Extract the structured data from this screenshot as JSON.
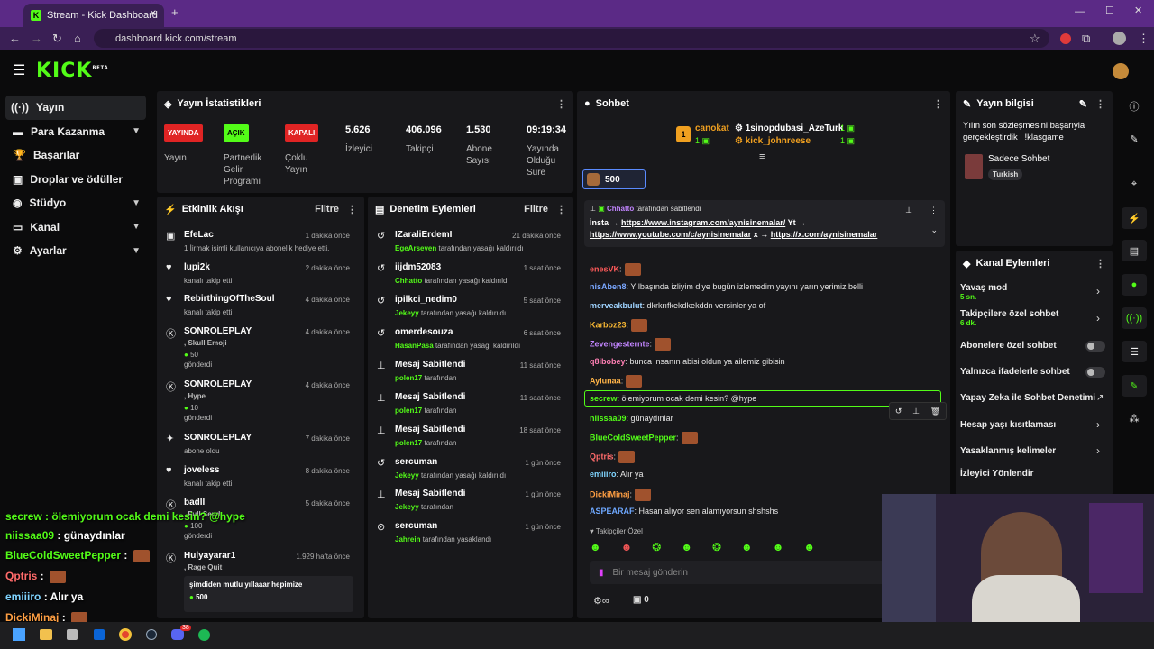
{
  "browser": {
    "tab_title": "Stream - Kick Dashboard",
    "url": "dashboard.kick.com/stream"
  },
  "logo": "KICK",
  "logo_sup": "BETA",
  "sidebar": [
    {
      "label": "Yayın",
      "icon": "antenna-icon"
    },
    {
      "label": "Para Kazanma",
      "icon": "money-icon"
    },
    {
      "label": "Başarılar",
      "icon": "trophy-icon"
    },
    {
      "label": "Droplar ve ödüller",
      "icon": "gift-icon"
    },
    {
      "label": "Stüdyo",
      "icon": "camera-icon"
    },
    {
      "label": "Kanal",
      "icon": "tv-icon"
    },
    {
      "label": "Ayarlar",
      "icon": "gear-icon"
    }
  ],
  "stats": {
    "title": "Yayın İstatistikleri",
    "items": [
      {
        "badge": "YAYINDA",
        "label": "Yayın"
      },
      {
        "badge": "AÇIK",
        "label": "Partnerlik Gelir Programı"
      },
      {
        "badge": "KAPALI",
        "label": "Çoklu Yayın"
      },
      {
        "value": "5.626",
        "label": "İzleyici"
      },
      {
        "value": "406.096",
        "label": "Takipçi"
      },
      {
        "value": "1.530",
        "label": "Abone Sayısı"
      },
      {
        "value": "09:19:34",
        "label": "Yayında Olduğu Süre"
      }
    ]
  },
  "activity": {
    "title": "Etkinlik Akışı",
    "filter": "Filtre",
    "items": [
      {
        "name": "EfeLac",
        "text": "1 İirmak isimli kullanıcıya abonelik hediye etti.",
        "time": "1 dakika önce"
      },
      {
        "name": "lupi2k",
        "text": "kanalı takip etti",
        "time": "2 dakika önce"
      },
      {
        "name": "RebirthingOfTheSoul",
        "text": "kanalı takip etti",
        "time": "4 dakika önce"
      },
      {
        "name": "SONROLEPLAY",
        "text": ", Skull Emoji",
        "amount": "50",
        "text2": "gönderdi",
        "time": "4 dakika önce"
      },
      {
        "name": "SONROLEPLAY",
        "text": ", Hype",
        "amount": "10",
        "text2": "gönderdi",
        "time": "4 dakika önce"
      },
      {
        "name": "SONROLEPLAY",
        "text": "abone oldu",
        "time": "7 dakika önce"
      },
      {
        "name": "joveless",
        "text": "kanalı takip etti",
        "time": "8 dakika önce"
      },
      {
        "name": "badll",
        "text": ", Full Send",
        "amount": "100",
        "text2": "gönderdi",
        "time": "5 dakika önce"
      },
      {
        "name": "Hulyayarar1",
        "text": ", Rage Quit",
        "time": "1.929 hafta önce"
      }
    ],
    "quote": "şimdiden mutlu yıllaaar hepimize",
    "quote_amount": "500"
  },
  "moderation": {
    "title": "Denetim Eylemleri",
    "filter": "Filtre",
    "items": [
      {
        "name": "IZaraliErdemI",
        "by": "EgeArseven",
        "text": "tarafından yasağı kaldırıldı",
        "time": "21 dakika önce"
      },
      {
        "name": "iijdm52083",
        "by": "Chhatto",
        "text": "tarafından yasağı kaldırıldı",
        "time": "1 saat önce"
      },
      {
        "name": "ipilkci_nedim0",
        "by": "Jekeyy",
        "text": "tarafından yasağı kaldırıldı",
        "time": "5 saat önce"
      },
      {
        "name": "omerdesouza",
        "by": "HasanPasa",
        "text": "tarafından yasağı kaldırıldı",
        "time": "6 saat önce"
      },
      {
        "name": "Mesaj Sabitlendi",
        "by": "polen17",
        "text": "tarafından",
        "time": "11 saat önce"
      },
      {
        "name": "Mesaj Sabitlendi",
        "by": "polen17",
        "text": "tarafından",
        "time": "11 saat önce"
      },
      {
        "name": "Mesaj Sabitlendi",
        "by": "polen17",
        "text": "tarafından",
        "time": "18 saat önce"
      },
      {
        "name": "sercuman",
        "by": "Jekeyy",
        "text": "tarafından yasağı kaldırıldı",
        "time": "1 gün önce"
      },
      {
        "name": "Mesaj Sabitlendi",
        "by": "Jekeyy",
        "text": "tarafından",
        "time": "1 gün önce"
      },
      {
        "name": "sercuman",
        "by": "Jahrein",
        "text": "tarafından yasaklandı",
        "time": "1 gün önce"
      }
    ]
  },
  "chat": {
    "title": "Sohbet",
    "top": [
      {
        "rank": "1",
        "name": "canokat",
        "count": "1"
      },
      {
        "name": "1sinopdubasi_AzeTurk",
        "count": "1"
      },
      {
        "name": "kick_johnreese",
        "count": "1"
      }
    ],
    "viewer_pill": "500",
    "pinned": {
      "by": "Chhatto",
      "by_text": "tarafından sabitlendi",
      "line1": "İnsta →",
      "link1": "https://www.instagram.com/aynisinemalar/",
      "line1b": "Yt →",
      "link2": "https://www.youtube.com/c/aynisinemalar",
      "mid": "x →",
      "link3": "https://x.com/aynisinemalar"
    },
    "messages": [
      {
        "user": "enesVK",
        "text": "",
        "emote": true,
        "color": "#ff5a5a"
      },
      {
        "user": "nisAben8",
        "text": "Yılbaşında izliyim diye bugün izlemedim yayını yarın yerimiz belli",
        "color": "#7aa7ff"
      },
      {
        "user": "merveakbulut",
        "text": "dkrkrıfkekdkekddn versinler ya of",
        "color": "#9fd3ff"
      },
      {
        "user": "Karboz23",
        "text": "",
        "emote": true,
        "color": "#f7b733"
      },
      {
        "user": "Zevengesternte",
        "text": "",
        "emote": true,
        "color": "#c285ff"
      },
      {
        "user": "q8ibobey",
        "text": "bunca insanın abisi oldun ya ailemiz gibisin",
        "color": "#ff7fb4"
      },
      {
        "user": "Aylunaa",
        "text": "",
        "emote": true,
        "color": "#ffb347"
      },
      {
        "user": "secrew",
        "text": "ölemiyorum ocak demi kesin? @hype",
        "color": "#53fc18",
        "highlight": true
      },
      {
        "user": "niissaa09",
        "text": "günaydınlar",
        "color": "#53fc18"
      },
      {
        "user": "BlueColdSweetPepper",
        "text": "",
        "emote": true,
        "color": "#53fc18"
      },
      {
        "user": "Qptris",
        "text": "",
        "emote": true,
        "color": "#ff6b6b"
      },
      {
        "user": "emiiiro",
        "text": "Alır ya",
        "color": "#7fd4ff"
      },
      {
        "user": "DickiMinaj",
        "text": "",
        "emote": true,
        "color": "#ff9f43"
      },
      {
        "user": "ASPEARAF",
        "text": "Hasan alıyor sen alamıyorsun shshshs",
        "color": "#6ea8ff"
      }
    ],
    "follower_label": "Takipçiler Özel",
    "input_placeholder": "Bir mesaj gönderin",
    "points": "0"
  },
  "streaminfo": {
    "title": "Yayın bilgisi",
    "stream_title": "Yılın son sözleşmesini başarıyla gerçekleştirdik | !klasgame",
    "category": "Sadece Sohbet",
    "tag": "Turkish"
  },
  "channel_actions": {
    "title": "Kanal Eylemleri",
    "items": [
      {
        "label": "Yavaş mod",
        "sub": "5 sn."
      },
      {
        "label": "Takipçilere özel sohbet",
        "sub": "6 dk."
      },
      {
        "label": "Abonelere özel sohbet"
      },
      {
        "label": "Yalnızca ifadelerle sohbet"
      },
      {
        "label": "Yapay Zeka ile Sohbet Denetimi"
      },
      {
        "label": "Hesap yaşı kısıtlaması"
      },
      {
        "label": "Yasaklanmış kelimeler"
      },
      {
        "label": "İzleyici Yönlendir"
      }
    ]
  },
  "overlay": [
    {
      "user": "secrew",
      "text": "ölemiyorum ocak demi kesin? @hype"
    },
    {
      "user": "niissaa09",
      "text": "günaydınlar"
    },
    {
      "user": "BlueColdSweetPepper",
      "text": ""
    },
    {
      "user": "Qptris",
      "text": ""
    },
    {
      "user": "emiiiro",
      "text": "Alır ya"
    },
    {
      "user": "DickiMinaj",
      "text": ""
    }
  ],
  "taskbar": {
    "badge": "38"
  }
}
